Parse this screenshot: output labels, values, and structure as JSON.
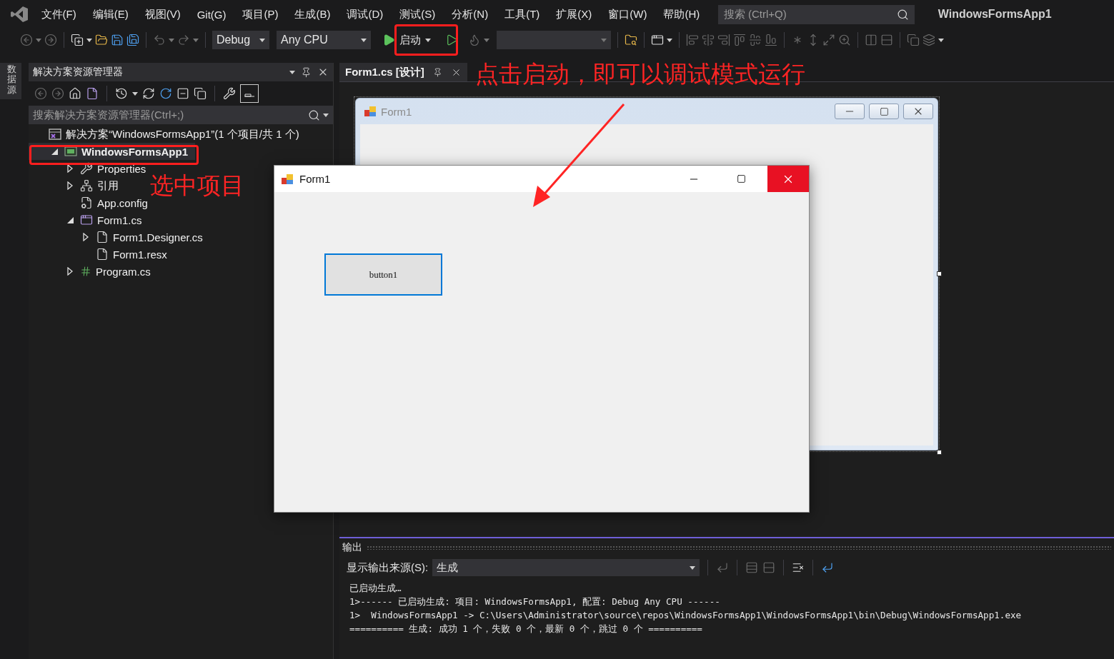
{
  "menu": [
    "文件(F)",
    "编辑(E)",
    "视图(V)",
    "Git(G)",
    "项目(P)",
    "生成(B)",
    "调试(D)",
    "测试(S)",
    "分析(N)",
    "工具(T)",
    "扩展(X)",
    "窗口(W)",
    "帮助(H)"
  ],
  "search": {
    "placeholder": "搜索 (Ctrl+Q)"
  },
  "app_title": "WindowsFormsApp1",
  "toolbar": {
    "configuration": "Debug",
    "platform": "Any CPU",
    "start": "启动"
  },
  "side_tabs": [
    "数据源"
  ],
  "solution_explorer": {
    "title": "解决方案资源管理器",
    "search": {
      "placeholder": "搜索解决方案资源管理器(Ctrl+;)"
    },
    "tree": [
      {
        "label": "解决方案“WindowsFormsApp1”(1 个项目/共 1 个)",
        "kind": "solution",
        "selected": false,
        "children": [
          {
            "label": "WindowsFormsApp1",
            "kind": "project",
            "selected": true,
            "expanded": true,
            "children": [
              {
                "label": "Properties",
                "kind": "properties",
                "selected": false,
                "expanded": false
              },
              {
                "label": "引用",
                "kind": "references",
                "selected": false,
                "expanded": false
              },
              {
                "label": "App.config",
                "kind": "config",
                "selected": false
              },
              {
                "label": "Form1.cs",
                "kind": "form",
                "selected": false,
                "expanded": true,
                "children": [
                  {
                    "label": "Form1.Designer.cs",
                    "kind": "file",
                    "selected": false,
                    "expanded": false
                  },
                  {
                    "label": "Form1.resx",
                    "kind": "file",
                    "selected": false
                  }
                ]
              },
              {
                "label": "Program.cs",
                "kind": "csharp",
                "selected": false,
                "expanded": false
              }
            ]
          }
        ]
      }
    ]
  },
  "designer": {
    "tab": {
      "label": "Form1.cs [设计]",
      "selected": true
    },
    "form": {
      "title": "Form1"
    }
  },
  "running_form": {
    "title": "Form1",
    "button": "button1"
  },
  "output": {
    "title": "输出",
    "source_label": "显示输出来源(S):",
    "source": "生成",
    "lines": [
      "已启动生成…",
      "1>------ 已启动生成: 项目: WindowsFormsApp1, 配置: Debug Any CPU ------",
      "1>  WindowsFormsApp1 -> C:\\Users\\Administrator\\source\\repos\\WindowsFormsApp1\\WindowsFormsApp1\\bin\\Debug\\WindowsFormsApp1.exe",
      "========== 生成: 成功 1 个，失败 0 个，最新 0 个，跳过 0 个 =========="
    ]
  },
  "annotations": {
    "start_note": "点击启动，即可以调试模式运行",
    "project_note": "选中项目"
  }
}
